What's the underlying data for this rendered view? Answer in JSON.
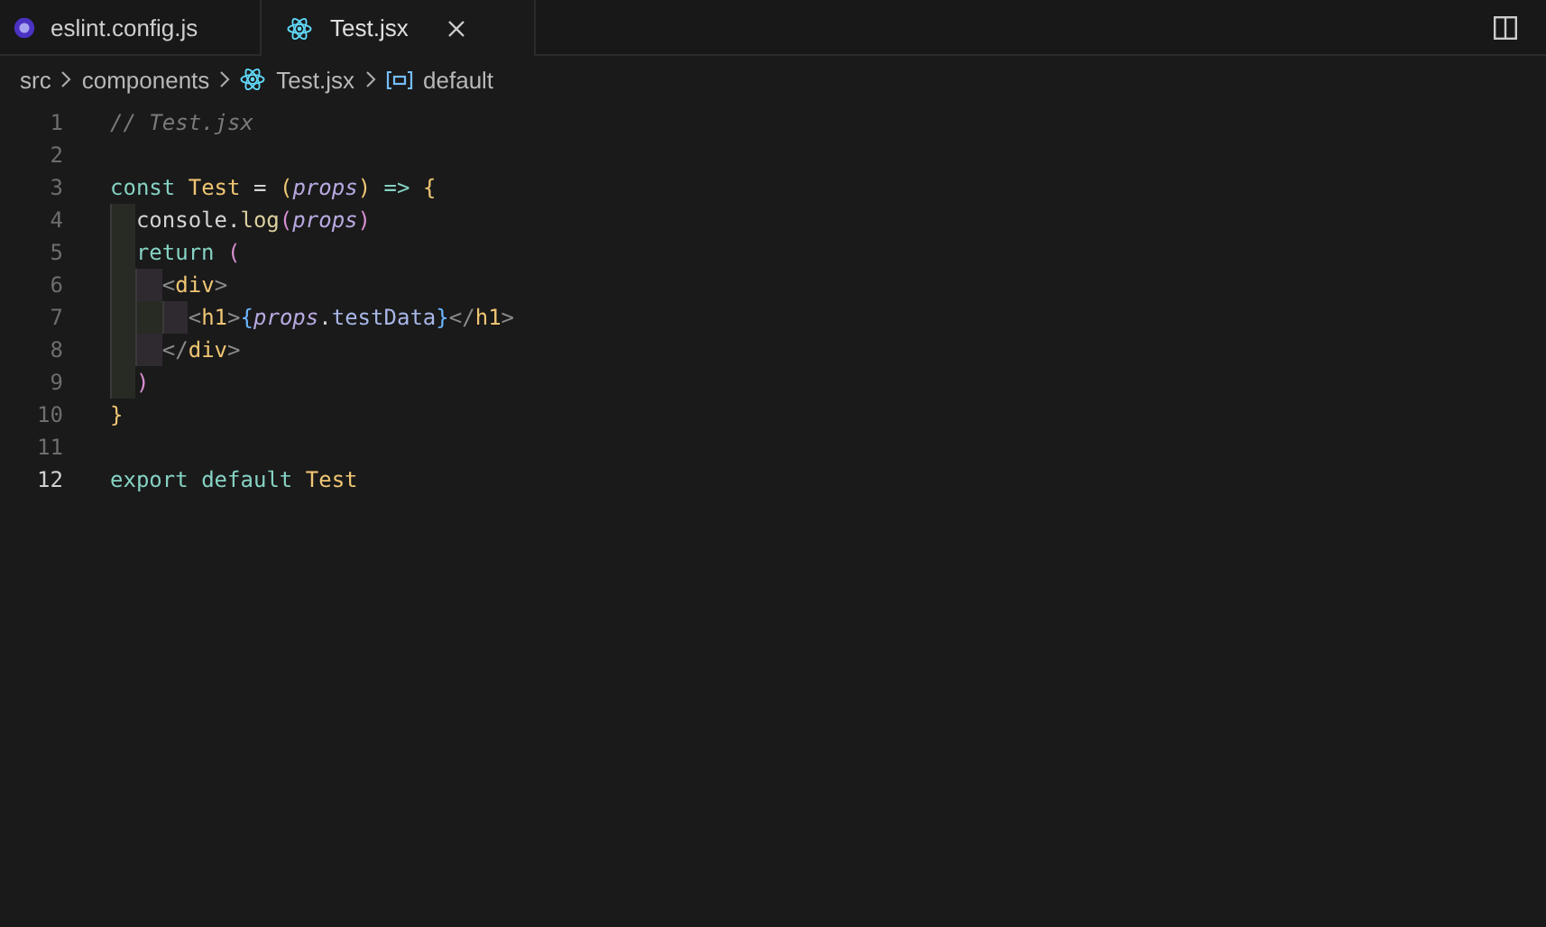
{
  "tabs": [
    {
      "label": "eslint.config.js",
      "kind": "eslint",
      "selected": false
    },
    {
      "label": "Test.jsx",
      "kind": "react",
      "selected": true
    }
  ],
  "breadcrumbs": [
    {
      "label": "src",
      "kind": "folder"
    },
    {
      "label": "components",
      "kind": "folder"
    },
    {
      "label": "Test.jsx",
      "kind": "react"
    },
    {
      "label": "default",
      "kind": "symbol"
    }
  ],
  "lines": [
    {
      "number": "1",
      "current": false,
      "tokens": [
        {
          "text": "// Test.jsx",
          "kind": "comment"
        }
      ]
    },
    {
      "number": "2",
      "current": false
    },
    {
      "number": "3",
      "current": false,
      "tokens": [
        {
          "text": "const ",
          "kind": "keyword"
        },
        {
          "text": "Test",
          "kind": "name"
        },
        {
          "text": " = ",
          "kind": "plain"
        },
        {
          "text": "(",
          "kind": "bracket1"
        },
        {
          "text": "props",
          "kind": "param"
        },
        {
          "text": ")",
          "kind": "bracket1"
        },
        {
          "text": " => ",
          "kind": "keyword"
        },
        {
          "text": "{",
          "kind": "bracket1"
        }
      ]
    },
    {
      "number": "4",
      "current": false,
      "tokens": [
        {
          "text": "  console.",
          "kind": "plain"
        },
        {
          "text": "log",
          "kind": "func"
        },
        {
          "text": "(",
          "kind": "bracket2"
        },
        {
          "text": "props",
          "kind": "param"
        },
        {
          "text": ")",
          "kind": "bracket2"
        }
      ]
    },
    {
      "number": "5",
      "current": false,
      "tokens": [
        {
          "text": "  return ",
          "kind": "keyword"
        },
        {
          "text": "(",
          "kind": "bracket2"
        }
      ]
    },
    {
      "number": "6",
      "current": false,
      "tokens": [
        {
          "text": "    <",
          "kind": "tagmark"
        },
        {
          "text": "div",
          "kind": "name"
        },
        {
          "text": ">",
          "kind": "tagmark"
        }
      ]
    },
    {
      "number": "7",
      "current": false,
      "tokens": [
        {
          "text": "      <",
          "kind": "tagmark"
        },
        {
          "text": "h1",
          "kind": "name"
        },
        {
          "text": ">",
          "kind": "tagmark"
        },
        {
          "text": "{",
          "kind": "bracket3"
        },
        {
          "text": "props",
          "kind": "param"
        },
        {
          "text": ".",
          "kind": "plain"
        },
        {
          "text": "testData",
          "kind": "prop"
        },
        {
          "text": "}",
          "kind": "bracket3"
        },
        {
          "text": "</",
          "kind": "tagmark"
        },
        {
          "text": "h1",
          "kind": "name"
        },
        {
          "text": ">",
          "kind": "tagmark"
        }
      ]
    },
    {
      "number": "8",
      "current": false,
      "tokens": [
        {
          "text": "    </",
          "kind": "tagmark"
        },
        {
          "text": "div",
          "kind": "name"
        },
        {
          "text": ">",
          "kind": "tagmark"
        }
      ]
    },
    {
      "number": "9",
      "current": false,
      "tokens": [
        {
          "text": "  )",
          "kind": "bracket2"
        }
      ]
    },
    {
      "number": "10",
      "current": false,
      "tokens": [
        {
          "text": "}",
          "kind": "bracket1"
        }
      ]
    },
    {
      "number": "11",
      "current": false
    },
    {
      "number": "12",
      "current": true,
      "tokens": [
        {
          "text": "export default ",
          "kind": "keyword"
        },
        {
          "text": "Test",
          "kind": "name"
        }
      ]
    }
  ]
}
